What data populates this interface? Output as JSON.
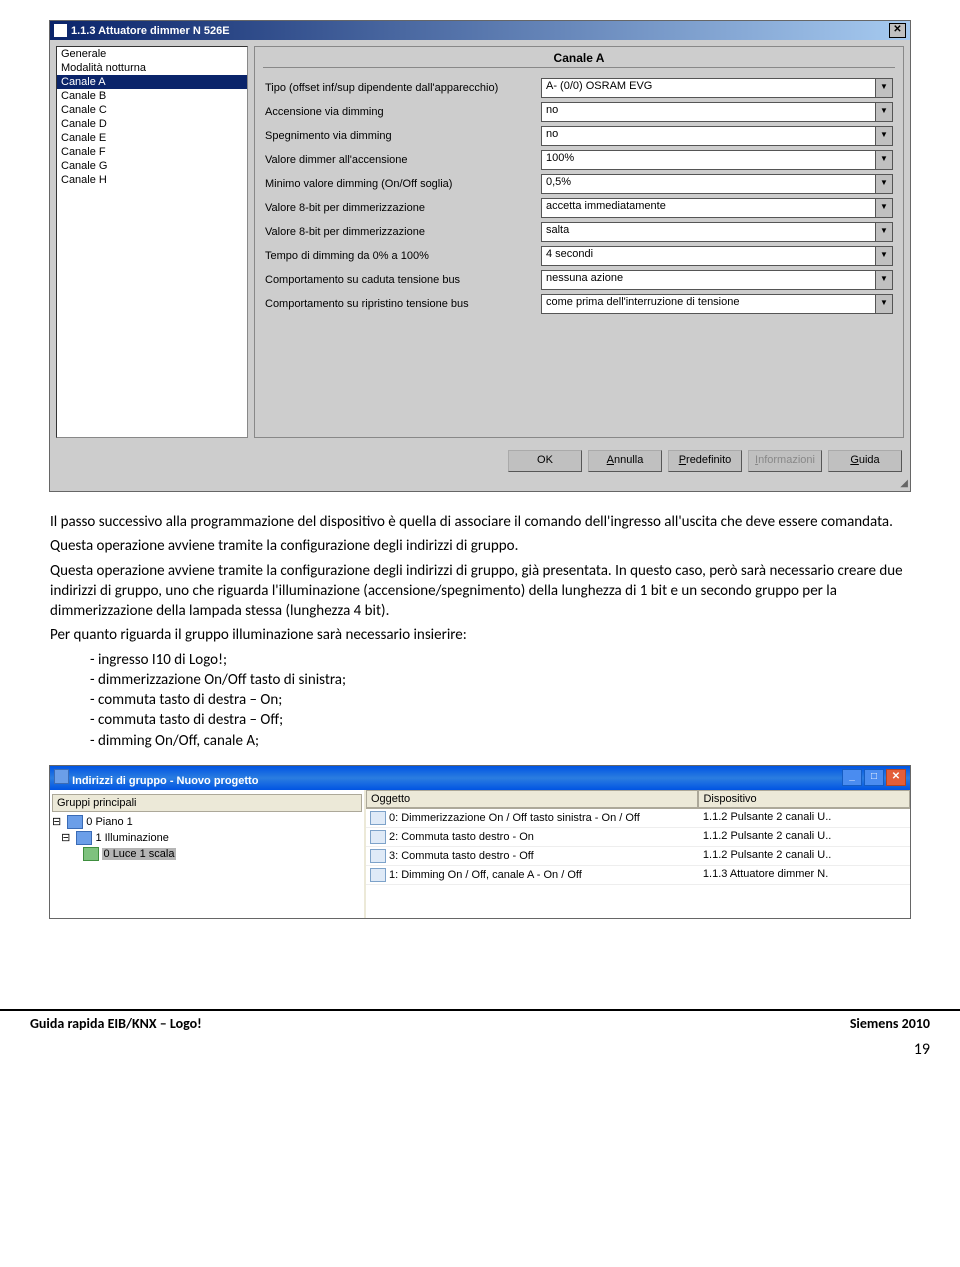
{
  "dialog1": {
    "title": "1.1.3 Attuatore dimmer N 526E",
    "list_items": [
      "Generale",
      "Modalità notturna",
      "Canale A",
      "Canale B",
      "Canale C",
      "Canale D",
      "Canale E",
      "Canale F",
      "Canale G",
      "Canale H"
    ],
    "list_selected_index": 2,
    "group_title": "Canale A",
    "rows": [
      {
        "label": "Tipo (offset inf/sup dipendente dall'apparecchio)",
        "value": "A- (0/0) OSRAM EVG"
      },
      {
        "label": "Accensione via dimming",
        "value": "no"
      },
      {
        "label": "Spegnimento via dimming",
        "value": "no"
      },
      {
        "label": "Valore dimmer all'accensione",
        "value": "100%"
      },
      {
        "label": "Minimo valore dimming (On/Off soglia)",
        "value": "0,5%"
      },
      {
        "label": "Valore 8-bit per dimmerizzazione",
        "value": "accetta immediatamente"
      },
      {
        "label": "Valore 8-bit per dimmerizzazione",
        "value": "salta"
      },
      {
        "label": "Tempo di dimming da 0% a 100%",
        "value": "4 secondi"
      },
      {
        "label": "Comportamento su caduta tensione bus",
        "value": "nessuna azione"
      },
      {
        "label": "Comportamento su ripristino tensione bus",
        "value": "come prima dell'interruzione di tensione"
      }
    ],
    "buttons": {
      "ok": "OK",
      "cancel": "Annulla",
      "default": "Predefinito",
      "info": "Informazioni",
      "help": "Guida"
    }
  },
  "body": {
    "p1": "Il passo successivo alla programmazione del dispositivo è quella di associare il comando dell'ingresso all'uscita che deve essere comandata.",
    "p2": "Questa operazione avviene tramite la configurazione degli indirizzi di gruppo.",
    "p3": "Questa operazione avviene tramite la configurazione degli indirizzi di gruppo, già presentata. In questo caso, però sarà necessario creare due indirizzi di gruppo, uno che riguarda l'illuminazione (accensione/spegnimento) della lunghezza di 1 bit e un secondo gruppo per la dimmerizzazione della lampada stessa (lunghezza 4 bit).",
    "p4": "Per quanto riguarda il gruppo illuminazione sarà necessario insierire:",
    "li1": "ingresso I10 di Logo!;",
    "li2": "dimmerizzazione On/Off tasto di sinistra;",
    "li3": "commuta tasto di destra – On;",
    "li4": "commuta tasto di destra – Off;",
    "li5": "dimming On/Off, canale A;"
  },
  "dialog2": {
    "title": "Indirizzi di gruppo - Nuovo progetto",
    "tree_header": "Gruppi principali",
    "tree_n1": "0 Piano 1",
    "tree_n2": "1 Illuminazione",
    "tree_n3": "0 Luce 1 scala",
    "table_h1": "Oggetto",
    "table_h2": "Dispositivo",
    "rows": [
      {
        "o": "0: Dimmerizzazione On / Off tasto sinistra - On / Off",
        "d": "1.1.2 Pulsante 2 canali U.."
      },
      {
        "o": "2: Commuta tasto destro - On",
        "d": "1.1.2 Pulsante 2 canali U.."
      },
      {
        "o": "3: Commuta tasto destro - Off",
        "d": "1.1.2 Pulsante 2 canali U.."
      },
      {
        "o": "1: Dimming On / Off, canale A - On / Off",
        "d": "1.1.3 Attuatore dimmer N."
      }
    ]
  },
  "footer": {
    "left": "Guida rapida EIB/KNX – Logo!",
    "right": "Siemens 2010",
    "page": "19"
  }
}
